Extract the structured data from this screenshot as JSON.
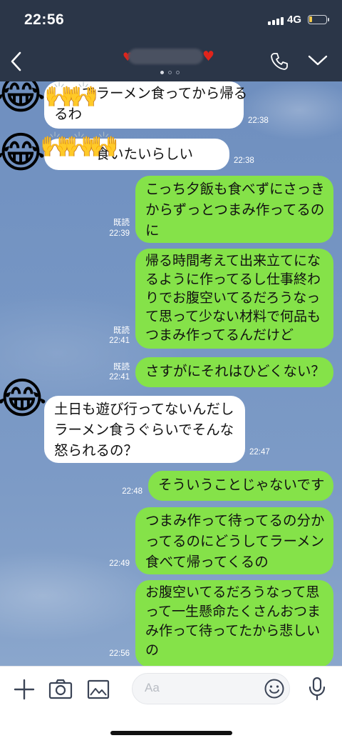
{
  "status": {
    "time": "22:56",
    "network": "4G"
  },
  "header": {
    "title_redacted": true,
    "page_indicator": "1 of 3"
  },
  "messages": [
    {
      "side": "in",
      "lines": "　　でラーメン食ってから帰る\nるわ",
      "time": "22:38",
      "read": ""
    },
    {
      "side": "in",
      "lines": "　　　食いたいらしい",
      "time": "22:38",
      "read": ""
    },
    {
      "side": "out",
      "lines": "こっち夕飯も食べずにさっき\nからずっとつまみ作ってるの\nに",
      "time": "22:39",
      "read": "既読"
    },
    {
      "side": "out",
      "lines": "帰る時間考えて出来立てにな\nるように作ってるし仕事終わ\nりでお腹空いてるだろうなっ\nて思って少ない材料で何品も\nつまみ作ってるんだけど",
      "time": "22:41",
      "read": "既読"
    },
    {
      "side": "out",
      "lines": "さすがにそれはひどくない？",
      "time": "22:41",
      "read": "既読"
    },
    {
      "side": "in",
      "lines": "土日も遊び行ってないんだし\nラーメン食うぐらいでそんな\n怒られるの？",
      "time": "22:47",
      "read": ""
    },
    {
      "side": "out",
      "lines": "そういうことじゃないです",
      "time": "22:48",
      "read": ""
    },
    {
      "side": "out",
      "lines": "つまみ作って待ってるの分か\nってるのにどうしてラーメン\n食べて帰ってくるの",
      "time": "22:49",
      "read": ""
    },
    {
      "side": "out",
      "lines": "お腹空いてるだろうなって思\nって一生懸命たくさんおつま\nみ作って待ってたから悲しい\nの",
      "time": "22:56",
      "read": ""
    }
  ],
  "stickers": {
    "laugh": "😂",
    "clap": "🙌"
  },
  "input": {
    "placeholder": "Aa"
  },
  "colors": {
    "header": "#2b3648",
    "out_bubble": "#85e249",
    "in_bubble": "#ffffff"
  }
}
